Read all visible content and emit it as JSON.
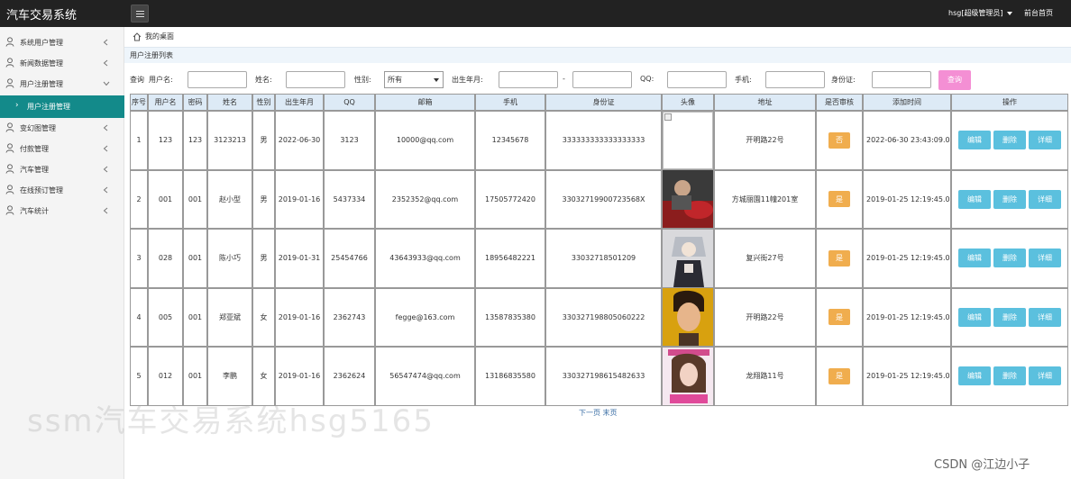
{
  "header": {
    "brand": "汽车交易系统",
    "user_menu": "hsg[超级管理员]",
    "front_link": "前台首页"
  },
  "sidebar": {
    "items": [
      {
        "label": "系统用户管理"
      },
      {
        "label": "新闻数据管理"
      },
      {
        "label": "用户注册管理"
      },
      {
        "label": "变幻图管理"
      },
      {
        "label": "付款管理"
      },
      {
        "label": "汽车管理"
      },
      {
        "label": "在线预订管理"
      },
      {
        "label": "汽车统计"
      }
    ],
    "active_sub": "用户注册管理"
  },
  "breadcrumb": "我的桌面",
  "panel_title": "用户注册列表",
  "search": {
    "prefix": "查询",
    "username_label": "用户名:",
    "name_label": "姓名:",
    "gender_label": "性别:",
    "gender_value": "所有",
    "birth_label": "出生年月:",
    "dash": "-",
    "qq_label": "QQ:",
    "phone_label": "手机:",
    "idcard_label": "身份证:",
    "button": "查询"
  },
  "table": {
    "headers": [
      "序号",
      "用户名",
      "密码",
      "姓名",
      "性别",
      "出生年月",
      "QQ",
      "邮箱",
      "手机",
      "身份证",
      "头像",
      "地址",
      "是否审核",
      "添加时间",
      "操作"
    ],
    "rows": [
      {
        "idx": "1",
        "username": "123",
        "password": "123",
        "name": "3123213",
        "gender": "男",
        "birth": "2022-06-30",
        "qq": "3123",
        "email": "10000@qq.com",
        "phone": "12345678",
        "idcard": "333333333333333333",
        "address": "开明路22号",
        "audit": "否",
        "added": "2022-06-30 23:43:09.0"
      },
      {
        "idx": "2",
        "username": "001",
        "password": "001",
        "name": "赵小型",
        "gender": "男",
        "birth": "2019-01-16",
        "qq": "5437334",
        "email": "2352352@qq.com",
        "phone": "17505772420",
        "idcard": "33032719900723568X",
        "address": "方城丽園11幢201室",
        "audit": "是",
        "added": "2019-01-25 12:19:45.0"
      },
      {
        "idx": "3",
        "username": "028",
        "password": "001",
        "name": "陈小巧",
        "gender": "男",
        "birth": "2019-01-31",
        "qq": "25454766",
        "email": "43643933@qq.com",
        "phone": "18956482221",
        "idcard": "33032718501209",
        "address": "复兴街27号",
        "audit": "是",
        "added": "2019-01-25 12:19:45.0"
      },
      {
        "idx": "4",
        "username": "005",
        "password": "001",
        "name": "郑亚斌",
        "gender": "女",
        "birth": "2019-01-16",
        "qq": "2362743",
        "email": "fegge@163.com",
        "phone": "13587835380",
        "idcard": "330327198805060222",
        "address": "开明路22号",
        "audit": "是",
        "added": "2019-01-25 12:19:45.0"
      },
      {
        "idx": "5",
        "username": "012",
        "password": "001",
        "name": "李鹏",
        "gender": "女",
        "birth": "2019-01-16",
        "qq": "2362624",
        "email": "56547474@qq.com",
        "phone": "13186835580",
        "idcard": "330327198615482633",
        "address": "龙翔路11号",
        "audit": "是",
        "added": "2019-01-25 12:19:45.0"
      }
    ],
    "actions": {
      "edit": "编辑",
      "delete": "删除",
      "detail": "详细"
    }
  },
  "pager": "下一页 末页",
  "watermark": "ssm汽车交易系统hsg5165",
  "credit": "CSDN @江边小子",
  "colors": {
    "topbar": "#222222",
    "sidebar_active": "#138a8a",
    "header_row": "#ddeaf6",
    "search_button": "#f48fd4",
    "audit_badge": "#f0ad4e",
    "action_button": "#5bc0de"
  }
}
